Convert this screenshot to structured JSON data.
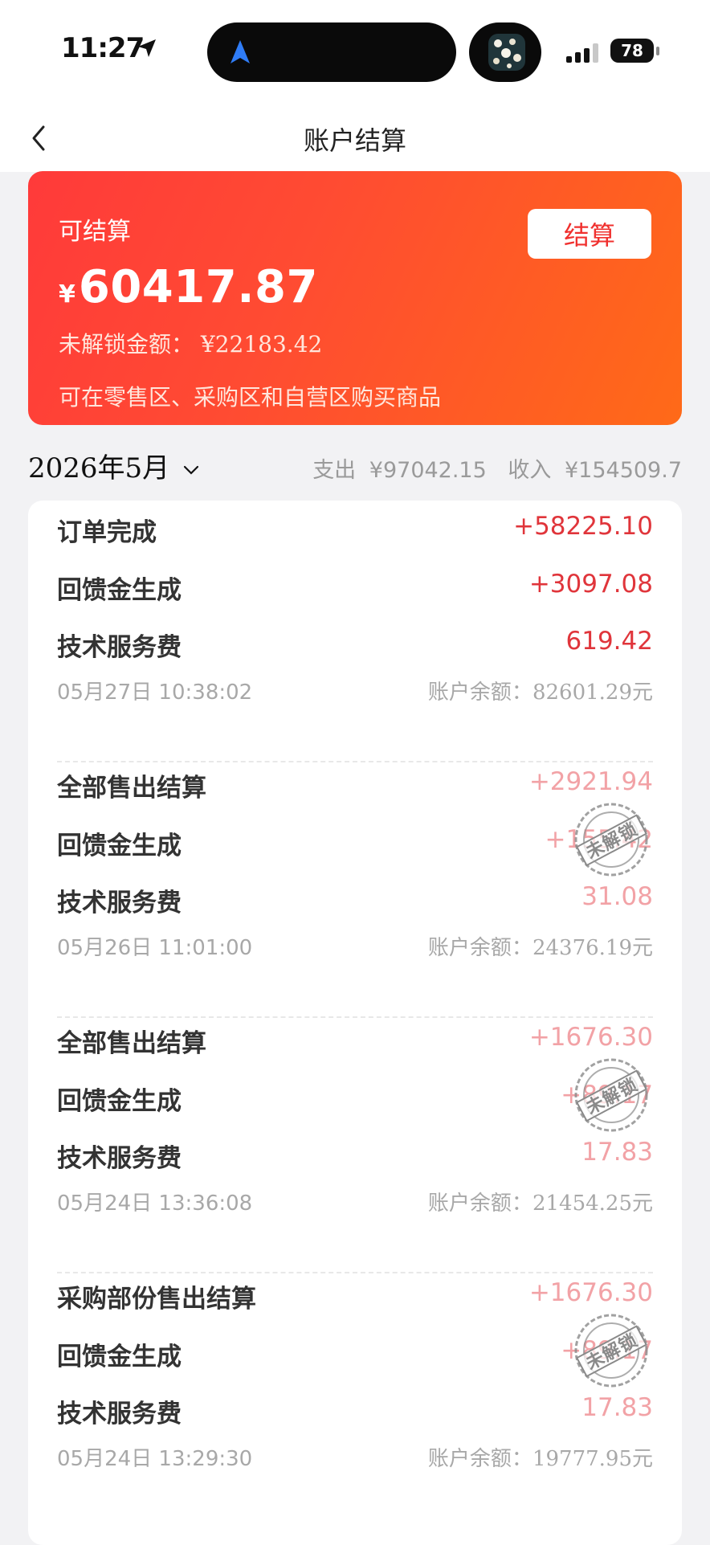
{
  "status_bar": {
    "time": "11:27",
    "battery": "78"
  },
  "nav": {
    "title": "账户结算"
  },
  "hero": {
    "label": "可结算",
    "currency": "¥",
    "amount": "60417.87",
    "locked_label": "未解锁金额：",
    "locked_amount": "¥22183.42",
    "note": "可在零售区、采购区和自营区购买商品",
    "settle_button": "结算",
    "gradient_start": "#ff3a3a",
    "gradient_end": "#ff6a18"
  },
  "month": {
    "label": "2026年5月",
    "expense_label": "支出",
    "expense": "¥97042.15",
    "income_label": "收入",
    "income": "¥154509.7"
  },
  "stamp_text": "未解锁",
  "entries": [
    {
      "rows": [
        {
          "label": "订单完成",
          "amount": "+58225.10"
        },
        {
          "label": "回馈金生成",
          "amount": "+3097.08"
        },
        {
          "label": "技术服务费",
          "amount": "619.42"
        }
      ],
      "time": "05月27日 10:38:02",
      "balance_label": "账户余额：",
      "balance": "82601.29元",
      "locked": false
    },
    {
      "rows": [
        {
          "label": "全部售出结算",
          "amount": "+2921.94"
        },
        {
          "label": "回馈金生成",
          "amount": "+155.42"
        },
        {
          "label": "技术服务费",
          "amount": "31.08"
        }
      ],
      "time": "05月26日 11:01:00",
      "balance_label": "账户余额：",
      "balance": "24376.19元",
      "locked": true
    },
    {
      "rows": [
        {
          "label": "全部售出结算",
          "amount": "+1676.30"
        },
        {
          "label": "回馈金生成",
          "amount": "+89.17"
        },
        {
          "label": "技术服务费",
          "amount": "17.83"
        }
      ],
      "time": "05月24日 13:36:08",
      "balance_label": "账户余额：",
      "balance": "21454.25元",
      "locked": true
    },
    {
      "rows": [
        {
          "label": "采购部份售出结算",
          "amount": "+1676.30"
        },
        {
          "label": "回馈金生成",
          "amount": "+89.17"
        },
        {
          "label": "技术服务费",
          "amount": "17.83"
        }
      ],
      "time": "05月24日 13:29:30",
      "balance_label": "账户余额：",
      "balance": "19777.95元",
      "locked": true
    }
  ],
  "colors": {
    "accent_red": "#e0353b",
    "locked_red": "#f2a2a6",
    "page_bg": "#f2f2f4"
  }
}
